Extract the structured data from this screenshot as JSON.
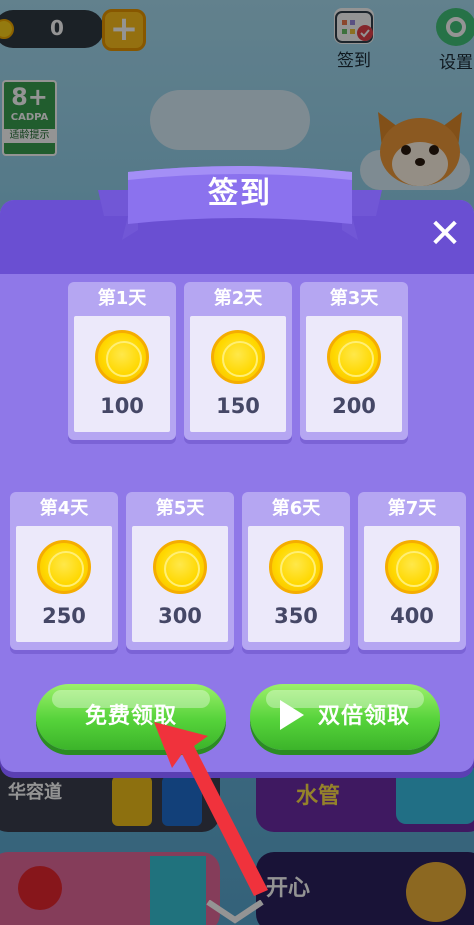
{
  "hud": {
    "coins": "0",
    "plus_label": "+",
    "age_rating": "8+",
    "age_org": "CADPA",
    "age_tip": "适龄提示",
    "signin_label": "签到",
    "settings_label": "设置"
  },
  "modal": {
    "title": "签到",
    "close": "✕",
    "days": [
      {
        "label": "第1天",
        "amount": "100"
      },
      {
        "label": "第2天",
        "amount": "150"
      },
      {
        "label": "第3天",
        "amount": "200"
      },
      {
        "label": "第4天",
        "amount": "250"
      },
      {
        "label": "第5天",
        "amount": "300"
      },
      {
        "label": "第6天",
        "amount": "350"
      },
      {
        "label": "第7天",
        "amount": "400"
      }
    ],
    "free_claim": "免费领取",
    "double_claim": "双倍领取"
  },
  "background_games": [
    "华容道",
    "水管",
    "开心"
  ],
  "colors": {
    "panel": "#8f78e8",
    "panel_header": "#6a4fd2",
    "button_green": "#55d23a",
    "coin_gold": "#ffd800",
    "arrow_red": "#f0323c"
  }
}
